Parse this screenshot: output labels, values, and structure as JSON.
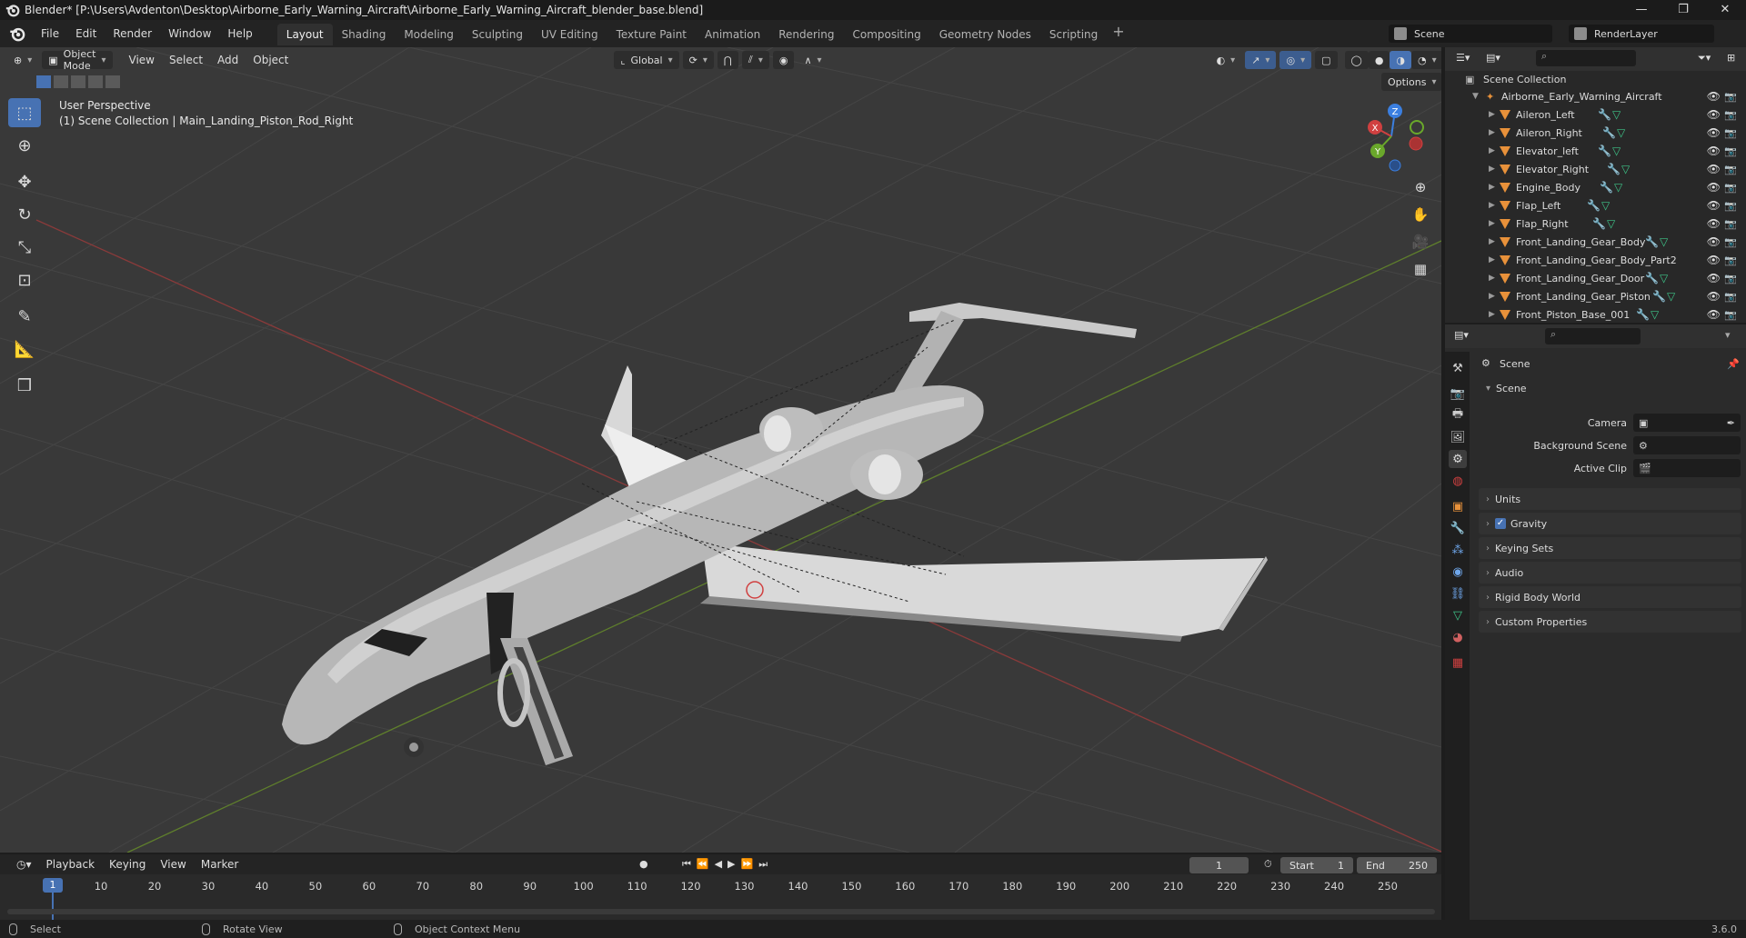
{
  "window": {
    "title": "Blender* [P:\\Users\\Avdenton\\Desktop\\Airborne_Early_Warning_Aircraft\\Airborne_Early_Warning_Aircraft_blender_base.blend]",
    "buttons": [
      "—",
      "❐",
      "✕"
    ]
  },
  "menu": [
    "File",
    "Edit",
    "Render",
    "Window",
    "Help"
  ],
  "workspaces": [
    "Layout",
    "Shading",
    "Modeling",
    "Sculpting",
    "UV Editing",
    "Texture Paint",
    "Animation",
    "Rendering",
    "Compositing",
    "Geometry Nodes",
    "Scripting"
  ],
  "workspace_active": "Layout",
  "scene_selector": "Scene",
  "view_layer": "RenderLayer",
  "viewport": {
    "mode": "Object Mode",
    "menus": [
      "View",
      "Select",
      "Add",
      "Object"
    ],
    "transform_orientation": "Global",
    "options_label": "Options",
    "perspective": "User Perspective",
    "context": "(1) Scene Collection | Main_Landing_Piston_Rod_Right",
    "gizmo": {
      "x": "X",
      "y": "Y",
      "z": "Z"
    }
  },
  "outliner": {
    "root": "Scene Collection",
    "collection": "Airborne_Early_Warning_Aircraft",
    "items": [
      "Aileron_Left",
      "Aileron_Right",
      "Elevator_left",
      "Elevator_Right",
      "Engine_Body",
      "Flap_Left",
      "Flap_Right",
      "Front_Landing_Gear_Body",
      "Front_Landing_Gear_Body_Part2",
      "Front_Landing_Gear_Door",
      "Front_Landing_Gear_Piston",
      "Front_Piston_Base_001"
    ]
  },
  "properties": {
    "context_title": "Scene",
    "panel_title": "Scene",
    "camera_label": "Camera",
    "background_scene_label": "Background Scene",
    "active_clip_label": "Active Clip",
    "subpanels": [
      "Units",
      "Gravity",
      "Keying Sets",
      "Audio",
      "Rigid Body World",
      "Custom Properties"
    ],
    "gravity_checked": true
  },
  "timeline": {
    "menus": [
      "Playback",
      "Keying",
      "View",
      "Marker"
    ],
    "current_frame": "1",
    "start_label": "Start",
    "start_value": "1",
    "end_label": "End",
    "end_value": "250",
    "ticks": [
      "1",
      "10",
      "20",
      "30",
      "40",
      "50",
      "60",
      "70",
      "80",
      "90",
      "100",
      "110",
      "120",
      "130",
      "140",
      "150",
      "160",
      "170",
      "180",
      "190",
      "200",
      "210",
      "220",
      "230",
      "240",
      "250"
    ]
  },
  "statusbar": {
    "select": "Select",
    "rotate": "Rotate View",
    "context_menu": "Object Context Menu",
    "version": "3.6.0"
  },
  "colors": {
    "accent": "#4772b3",
    "object_orange": "#e8913a",
    "modifier_blue": "#6fa7ec",
    "mesh_green": "#3ec488"
  }
}
